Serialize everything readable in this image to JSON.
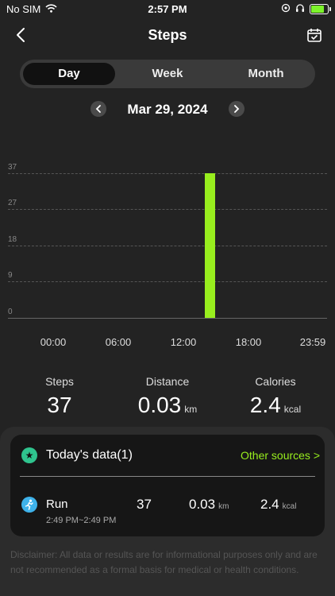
{
  "status_bar": {
    "carrier": "No SIM",
    "time": "2:57 PM"
  },
  "nav": {
    "title": "Steps"
  },
  "segments": [
    {
      "label": "Day",
      "active": true
    },
    {
      "label": "Week",
      "active": false
    },
    {
      "label": "Month",
      "active": false
    }
  ],
  "date": {
    "text": "Mar 29, 2024"
  },
  "chart_data": {
    "type": "bar",
    "y_ticks": [
      "37",
      "27",
      "18",
      "9",
      "0"
    ],
    "x_ticks": [
      "00:00",
      "06:00",
      "12:00",
      "18:00",
      "23:59"
    ],
    "ylim": [
      0,
      37
    ],
    "bars": [
      {
        "hour": 14.5,
        "value": 37
      }
    ],
    "bar_color": "#98ee1e"
  },
  "stats": {
    "steps": {
      "label": "Steps",
      "value": "37",
      "unit": ""
    },
    "distance": {
      "label": "Distance",
      "value": "0.03",
      "unit": "km"
    },
    "calories": {
      "label": "Calories",
      "value": "2.4",
      "unit": "kcal"
    }
  },
  "today": {
    "title": "Today's data(1)",
    "other_sources": "Other sources >",
    "activity": {
      "label": "Run",
      "time_range": "2:49 PM~2:49 PM",
      "steps": "37",
      "distance": "0.03",
      "distance_unit": "km",
      "calories": "2.4",
      "calories_unit": "kcal"
    }
  },
  "disclaimer": "Disclaimer: All data or results are for informational purposes only and are not recommended as a formal basis for medical or health conditions."
}
